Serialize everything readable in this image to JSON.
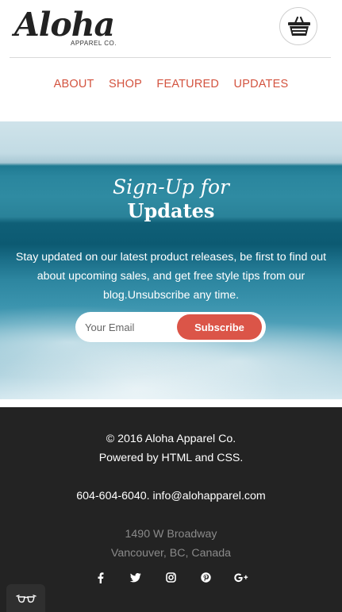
{
  "header": {
    "logo_main": "Aloha",
    "logo_sub": "APPAREL CO.",
    "cart_icon": "shopping-basket-icon"
  },
  "nav": {
    "items": [
      {
        "label": "ABOUT"
      },
      {
        "label": "SHOP"
      },
      {
        "label": "FEATURED"
      },
      {
        "label": "UPDATES"
      }
    ]
  },
  "hero": {
    "title_line1": "Sign-Up for",
    "title_line2": "Updates",
    "text": "Stay updated on our latest product releases, be first to find out about upcoming sales, and get free style tips from our blog.Unsubscribe any time.",
    "email_placeholder": "Your Email",
    "subscribe_label": "Subscribe"
  },
  "footer": {
    "copyright": "© 2016 Aloha Apparel Co.",
    "powered": "Powered by HTML and CSS.",
    "contact": "604-604-6040. info@alohapparel.com",
    "address_line1": "1490 W Broadway",
    "address_line2": "Vancouver, BC, Canada",
    "social": [
      "facebook-icon",
      "twitter-icon",
      "instagram-icon",
      "pinterest-icon",
      "google-plus-icon"
    ]
  },
  "colors": {
    "accent": "#d3533f",
    "button": "#db5548",
    "footer_bg": "#232323"
  }
}
